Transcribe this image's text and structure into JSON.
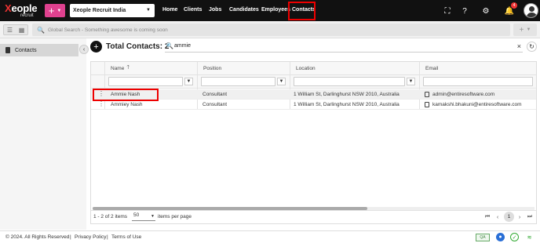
{
  "brand": {
    "name_prefix": "X",
    "name_rest": "eople",
    "subtitle": "recruit"
  },
  "topbar": {
    "plus_label": "+",
    "company": "Xeople Recruit India",
    "nav": [
      "Home",
      "Clients",
      "Jobs",
      "Candidates",
      "Employees",
      "Contacts"
    ],
    "active_nav": "Contacts",
    "notification_count": "4"
  },
  "search": {
    "placeholder": "Global Search - Something awesome is coming soon"
  },
  "sidebar": {
    "items": [
      {
        "label": "Contacts"
      }
    ]
  },
  "header": {
    "total_label": "Total Contacts: 2",
    "search_value": "ammie"
  },
  "table": {
    "columns": [
      "Name",
      "Position",
      "Location",
      "Email"
    ],
    "rows": [
      {
        "name": "Ammie Nash",
        "position": "Consultant",
        "location": "1 William St, Darlinghurst NSW 2010, Australia",
        "email": "admin@entiresoftware.com"
      },
      {
        "name": "Ammiey Nash",
        "position": "Consultant",
        "location": "1 William St, Darlinghurst NSW 2010, Australia",
        "email": "kamakshi.bhakuni@entiresoftware.com"
      }
    ]
  },
  "pager": {
    "range": "1 - 2 of 2 items",
    "page_size": "50",
    "items_per_page": "items per page",
    "current_page": "1"
  },
  "footer": {
    "copyright": "© 2024. All Rights Reserved",
    "sep": "|",
    "privacy": "Privacy Policy",
    "terms": "Terms of Use",
    "qa": "QA"
  },
  "colors": {
    "accent_pink": "#e0418f",
    "highlight_red": "#e00000",
    "topbar": "#111111"
  }
}
